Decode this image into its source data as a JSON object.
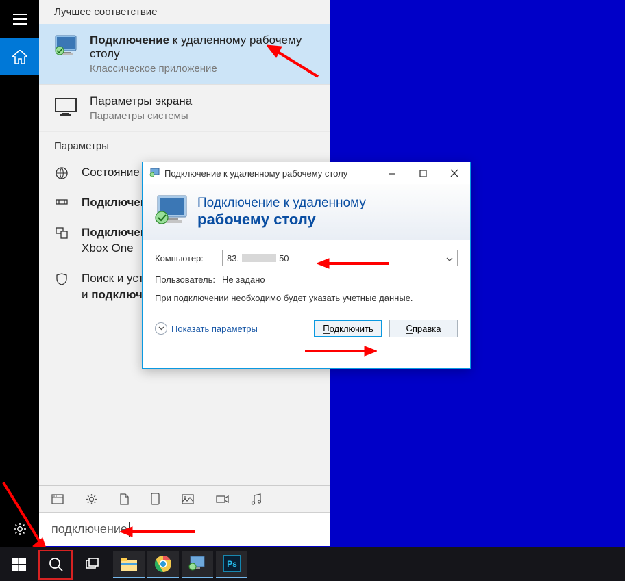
{
  "start_panel": {
    "header": "Лучшее соответствие",
    "best_match": {
      "title_bold": "Подключение",
      "title_rest": " к удаленному рабочему столу",
      "subtitle": "Классическое приложение"
    },
    "result2": {
      "title": "Параметры экрана",
      "subtitle": "Параметры системы"
    },
    "section_label": "Параметры",
    "params": [
      {
        "text": "Состояние сети"
      },
      {
        "text_bold": "Подключение"
      },
      {
        "text_html": "Подключение к Xbox One",
        "bold1": "Подключение",
        "rest1": " к",
        "line2": "Xbox One"
      },
      {
        "line1a": "Поиск и устранение",
        "line2a": "и ",
        "line2b": "подключения"
      }
    ],
    "search_value": "подключение"
  },
  "dialog": {
    "title": "Подключение к удаленному рабочему столу",
    "header_line1": "Подключение к удаленному",
    "header_line2": "рабочему столу",
    "computer_label": "Компьютер:",
    "computer_value_left": "83.",
    "computer_value_right": "50",
    "user_label": "Пользователь:",
    "user_value": "Не задано",
    "hint": "При подключении необходимо будет указать учетные данные.",
    "show_options": "Показать параметры",
    "connect_btn": "Подключить",
    "help_btn": "Справка"
  },
  "icons": {
    "rdp": "rdp-icon",
    "monitor": "monitor-icon"
  }
}
